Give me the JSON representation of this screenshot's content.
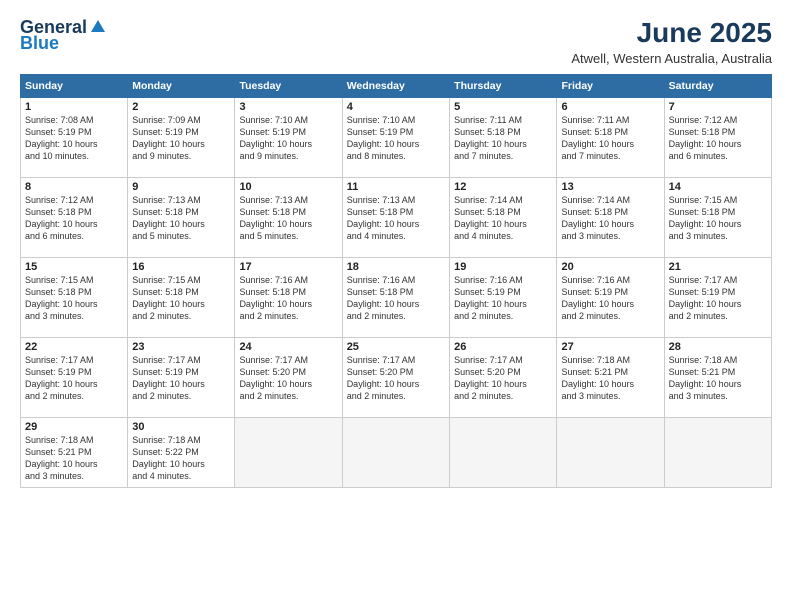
{
  "logo": {
    "general": "General",
    "blue": "Blue"
  },
  "header": {
    "month": "June 2025",
    "location": "Atwell, Western Australia, Australia"
  },
  "weekdays": [
    "Sunday",
    "Monday",
    "Tuesday",
    "Wednesday",
    "Thursday",
    "Friday",
    "Saturday"
  ],
  "weeks": [
    [
      {
        "day": "1",
        "detail": "Sunrise: 7:08 AM\nSunset: 5:19 PM\nDaylight: 10 hours\nand 10 minutes."
      },
      {
        "day": "2",
        "detail": "Sunrise: 7:09 AM\nSunset: 5:19 PM\nDaylight: 10 hours\nand 9 minutes."
      },
      {
        "day": "3",
        "detail": "Sunrise: 7:10 AM\nSunset: 5:19 PM\nDaylight: 10 hours\nand 9 minutes."
      },
      {
        "day": "4",
        "detail": "Sunrise: 7:10 AM\nSunset: 5:19 PM\nDaylight: 10 hours\nand 8 minutes."
      },
      {
        "day": "5",
        "detail": "Sunrise: 7:11 AM\nSunset: 5:18 PM\nDaylight: 10 hours\nand 7 minutes."
      },
      {
        "day": "6",
        "detail": "Sunrise: 7:11 AM\nSunset: 5:18 PM\nDaylight: 10 hours\nand 7 minutes."
      },
      {
        "day": "7",
        "detail": "Sunrise: 7:12 AM\nSunset: 5:18 PM\nDaylight: 10 hours\nand 6 minutes."
      }
    ],
    [
      {
        "day": "8",
        "detail": "Sunrise: 7:12 AM\nSunset: 5:18 PM\nDaylight: 10 hours\nand 6 minutes."
      },
      {
        "day": "9",
        "detail": "Sunrise: 7:13 AM\nSunset: 5:18 PM\nDaylight: 10 hours\nand 5 minutes."
      },
      {
        "day": "10",
        "detail": "Sunrise: 7:13 AM\nSunset: 5:18 PM\nDaylight: 10 hours\nand 5 minutes."
      },
      {
        "day": "11",
        "detail": "Sunrise: 7:13 AM\nSunset: 5:18 PM\nDaylight: 10 hours\nand 4 minutes."
      },
      {
        "day": "12",
        "detail": "Sunrise: 7:14 AM\nSunset: 5:18 PM\nDaylight: 10 hours\nand 4 minutes."
      },
      {
        "day": "13",
        "detail": "Sunrise: 7:14 AM\nSunset: 5:18 PM\nDaylight: 10 hours\nand 3 minutes."
      },
      {
        "day": "14",
        "detail": "Sunrise: 7:15 AM\nSunset: 5:18 PM\nDaylight: 10 hours\nand 3 minutes."
      }
    ],
    [
      {
        "day": "15",
        "detail": "Sunrise: 7:15 AM\nSunset: 5:18 PM\nDaylight: 10 hours\nand 3 minutes."
      },
      {
        "day": "16",
        "detail": "Sunrise: 7:15 AM\nSunset: 5:18 PM\nDaylight: 10 hours\nand 2 minutes."
      },
      {
        "day": "17",
        "detail": "Sunrise: 7:16 AM\nSunset: 5:18 PM\nDaylight: 10 hours\nand 2 minutes."
      },
      {
        "day": "18",
        "detail": "Sunrise: 7:16 AM\nSunset: 5:18 PM\nDaylight: 10 hours\nand 2 minutes."
      },
      {
        "day": "19",
        "detail": "Sunrise: 7:16 AM\nSunset: 5:19 PM\nDaylight: 10 hours\nand 2 minutes."
      },
      {
        "day": "20",
        "detail": "Sunrise: 7:16 AM\nSunset: 5:19 PM\nDaylight: 10 hours\nand 2 minutes."
      },
      {
        "day": "21",
        "detail": "Sunrise: 7:17 AM\nSunset: 5:19 PM\nDaylight: 10 hours\nand 2 minutes."
      }
    ],
    [
      {
        "day": "22",
        "detail": "Sunrise: 7:17 AM\nSunset: 5:19 PM\nDaylight: 10 hours\nand 2 minutes."
      },
      {
        "day": "23",
        "detail": "Sunrise: 7:17 AM\nSunset: 5:19 PM\nDaylight: 10 hours\nand 2 minutes."
      },
      {
        "day": "24",
        "detail": "Sunrise: 7:17 AM\nSunset: 5:20 PM\nDaylight: 10 hours\nand 2 minutes."
      },
      {
        "day": "25",
        "detail": "Sunrise: 7:17 AM\nSunset: 5:20 PM\nDaylight: 10 hours\nand 2 minutes."
      },
      {
        "day": "26",
        "detail": "Sunrise: 7:17 AM\nSunset: 5:20 PM\nDaylight: 10 hours\nand 2 minutes."
      },
      {
        "day": "27",
        "detail": "Sunrise: 7:18 AM\nSunset: 5:21 PM\nDaylight: 10 hours\nand 3 minutes."
      },
      {
        "day": "28",
        "detail": "Sunrise: 7:18 AM\nSunset: 5:21 PM\nDaylight: 10 hours\nand 3 minutes."
      }
    ],
    [
      {
        "day": "29",
        "detail": "Sunrise: 7:18 AM\nSunset: 5:21 PM\nDaylight: 10 hours\nand 3 minutes."
      },
      {
        "day": "30",
        "detail": "Sunrise: 7:18 AM\nSunset: 5:22 PM\nDaylight: 10 hours\nand 4 minutes."
      },
      {
        "day": "",
        "detail": ""
      },
      {
        "day": "",
        "detail": ""
      },
      {
        "day": "",
        "detail": ""
      },
      {
        "day": "",
        "detail": ""
      },
      {
        "day": "",
        "detail": ""
      }
    ]
  ]
}
